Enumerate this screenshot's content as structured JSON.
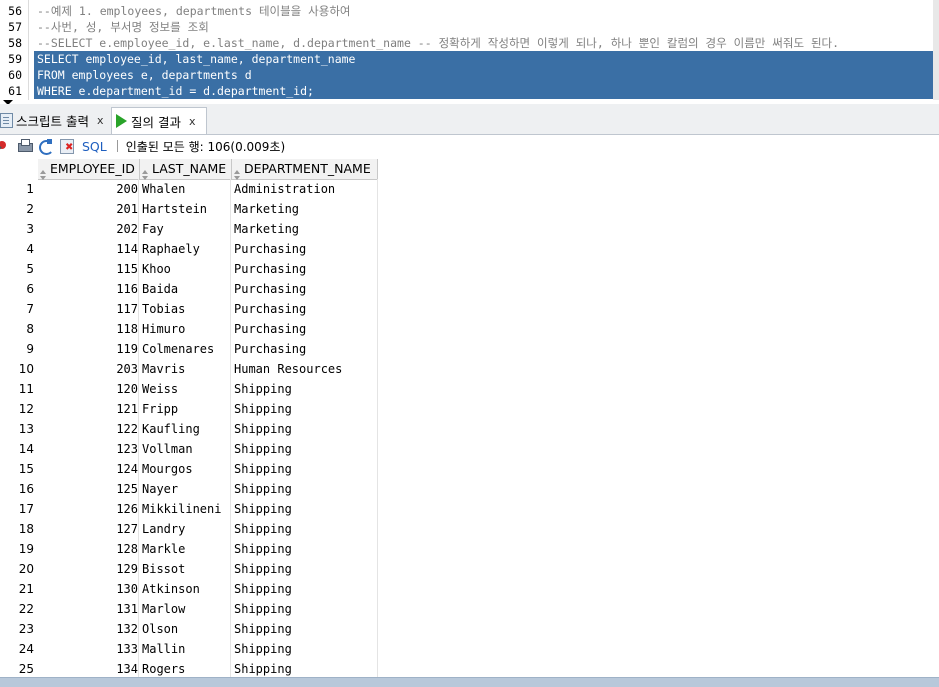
{
  "editor": {
    "lines": [
      {
        "no": "56",
        "text": "--예제 1. employees, departments 테이블을 사용하여",
        "kind": "comment"
      },
      {
        "no": "57",
        "text": "--사번, 성, 부서명 정보를 조회",
        "kind": "comment"
      },
      {
        "no": "58",
        "text": "--SELECT e.employee_id, e.last_name, d.department_name -- 정확하게 작성하면 이렇게 되나, 하나 뿐인 칼럼의 경우 이름만 써줘도 된다.",
        "kind": "comment"
      },
      {
        "no": "59",
        "text": "SELECT employee_id, last_name, department_name",
        "kind": "selected"
      },
      {
        "no": "60",
        "text": "FROM employees e, departments d",
        "kind": "selected"
      },
      {
        "no": "61",
        "text": "WHERE e.department_id = d.department_id;",
        "kind": "selected"
      }
    ]
  },
  "tabs": {
    "script_output": {
      "label": "스크립트 출력",
      "close": "x"
    },
    "query_result": {
      "label": "질의 결과",
      "close": "x"
    }
  },
  "toolbar": {
    "sql_label": "SQL",
    "fetch_status": "인출된 모든 행: 106(0.009초)"
  },
  "grid": {
    "columns": [
      "EMPLOYEE_ID",
      "LAST_NAME",
      "DEPARTMENT_NAME"
    ],
    "rows": [
      {
        "num": "1",
        "id": "200",
        "name": "Whalen",
        "dept": "Administration"
      },
      {
        "num": "2",
        "id": "201",
        "name": "Hartstein",
        "dept": "Marketing"
      },
      {
        "num": "3",
        "id": "202",
        "name": "Fay",
        "dept": "Marketing"
      },
      {
        "num": "4",
        "id": "114",
        "name": "Raphaely",
        "dept": "Purchasing"
      },
      {
        "num": "5",
        "id": "115",
        "name": "Khoo",
        "dept": "Purchasing"
      },
      {
        "num": "6",
        "id": "116",
        "name": "Baida",
        "dept": "Purchasing"
      },
      {
        "num": "7",
        "id": "117",
        "name": "Tobias",
        "dept": "Purchasing"
      },
      {
        "num": "8",
        "id": "118",
        "name": "Himuro",
        "dept": "Purchasing"
      },
      {
        "num": "9",
        "id": "119",
        "name": "Colmenares",
        "dept": "Purchasing"
      },
      {
        "num": "10",
        "id": "203",
        "name": "Mavris",
        "dept": "Human Resources"
      },
      {
        "num": "11",
        "id": "120",
        "name": "Weiss",
        "dept": "Shipping"
      },
      {
        "num": "12",
        "id": "121",
        "name": "Fripp",
        "dept": "Shipping"
      },
      {
        "num": "13",
        "id": "122",
        "name": "Kaufling",
        "dept": "Shipping"
      },
      {
        "num": "14",
        "id": "123",
        "name": "Vollman",
        "dept": "Shipping"
      },
      {
        "num": "15",
        "id": "124",
        "name": "Mourgos",
        "dept": "Shipping"
      },
      {
        "num": "16",
        "id": "125",
        "name": "Nayer",
        "dept": "Shipping"
      },
      {
        "num": "17",
        "id": "126",
        "name": "Mikkilineni",
        "dept": "Shipping"
      },
      {
        "num": "18",
        "id": "127",
        "name": "Landry",
        "dept": "Shipping"
      },
      {
        "num": "19",
        "id": "128",
        "name": "Markle",
        "dept": "Shipping"
      },
      {
        "num": "20",
        "id": "129",
        "name": "Bissot",
        "dept": "Shipping"
      },
      {
        "num": "21",
        "id": "130",
        "name": "Atkinson",
        "dept": "Shipping"
      },
      {
        "num": "22",
        "id": "131",
        "name": "Marlow",
        "dept": "Shipping"
      },
      {
        "num": "23",
        "id": "132",
        "name": "Olson",
        "dept": "Shipping"
      },
      {
        "num": "24",
        "id": "133",
        "name": "Mallin",
        "dept": "Shipping"
      },
      {
        "num": "25",
        "id": "134",
        "name": "Rogers",
        "dept": "Shipping"
      }
    ]
  },
  "colors": {
    "selection": "#3a6fa5",
    "run_icon": "#29a329",
    "sql_link": "#1f5fbf"
  }
}
